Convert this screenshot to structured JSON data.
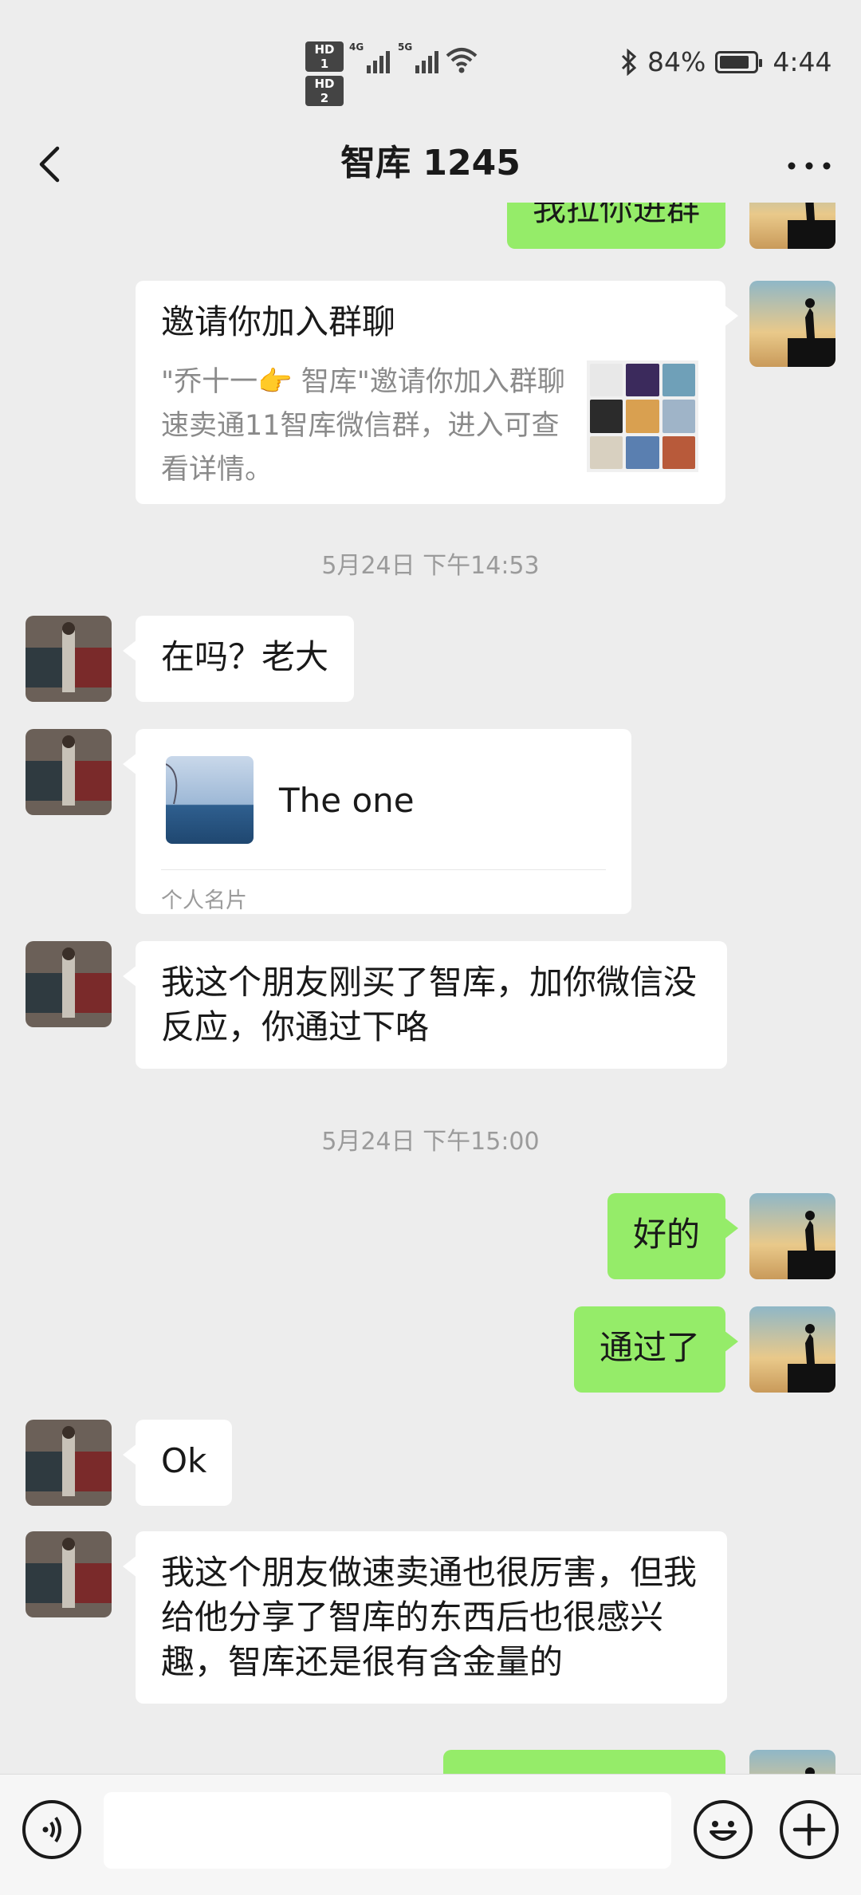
{
  "status_bar": {
    "sim1": "HD 1",
    "sim2": "HD 2",
    "net1": "4G",
    "net2": "5G",
    "battery_percent": "84%",
    "battery_level": 0.84,
    "time": "4:44"
  },
  "nav": {
    "title": "智库 1245"
  },
  "messages": {
    "m0_text": "我拉你进群",
    "invite_title": "邀请你加入群聊",
    "invite_desc": "\"乔十一👉 智库\"邀请你加入群聊速卖通11智库微信群，进入可查看详情。",
    "ts1": "5月24日 下午14:53",
    "m2_text": "在吗？老大",
    "card_name": "The one",
    "card_type": "个人名片",
    "m4_text": "我这个朋友刚买了智库，加你微信没反应，你通过下咯",
    "ts2": "5月24日 下午15:00",
    "m5_text": "好的",
    "m6_text": "通过了",
    "m7_text": "Ok",
    "m8_text": "我这个朋友做速卖通也很厉害，但我给他分享了智库的东西后也很感兴趣，智库还是很有含金量的"
  },
  "colors": {
    "background": "#ededed",
    "mine_bubble": "#95ec69",
    "their_bubble": "#ffffff",
    "timestamp": "#9b9b9b"
  },
  "icons": {
    "back": "chevron-left-icon",
    "more": "more-dots-icon",
    "voice": "voice-icon",
    "emoji": "emoji-icon",
    "plus": "plus-icon"
  }
}
